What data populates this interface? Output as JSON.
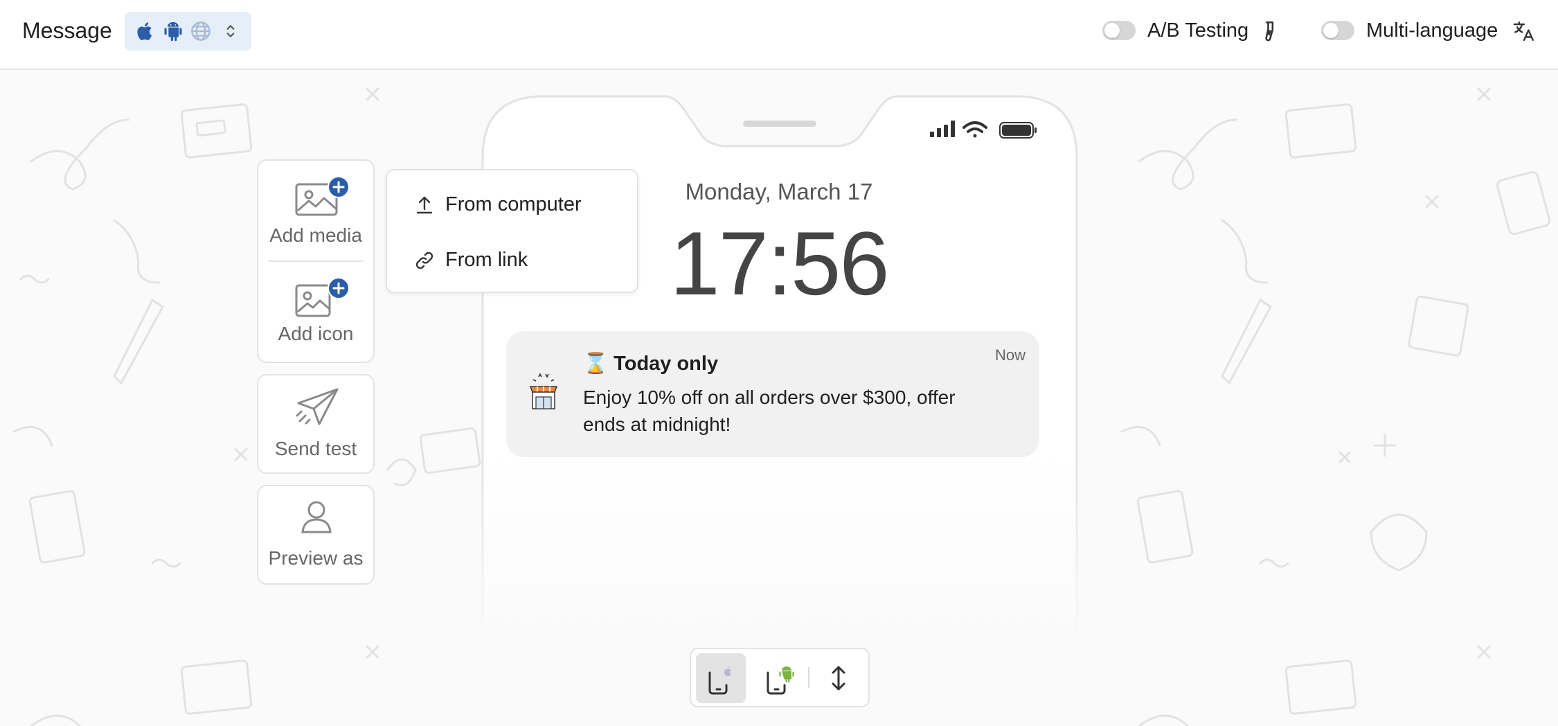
{
  "header": {
    "title": "Message",
    "platforms": [
      "apple-icon",
      "android-icon",
      "globe-icon"
    ],
    "ab_testing_label": "A/B Testing",
    "multi_language_label": "Multi-language",
    "ab_testing_enabled": false,
    "multi_language_enabled": false
  },
  "tools": {
    "add_media": "Add media",
    "add_icon": "Add icon",
    "send_test": "Send test",
    "preview_as": "Preview as"
  },
  "dropdown": {
    "from_computer": "From computer",
    "from_link": "From link"
  },
  "lockscreen": {
    "date": "Monday, March 17",
    "time": "17:56"
  },
  "notification": {
    "title": "⌛ Today only",
    "time": "Now",
    "body": "Enjoy 10% off on all orders over $300, offer ends at midnight!"
  },
  "device_switcher": {
    "options": [
      "ios-preview",
      "android-preview",
      "expand-collapse"
    ],
    "selected": "ios-preview"
  },
  "colors": {
    "accent": "#2b5ea6",
    "platform_select_bg": "#e6eef8",
    "border": "#e3e3e3",
    "android_green": "#7cb342"
  }
}
